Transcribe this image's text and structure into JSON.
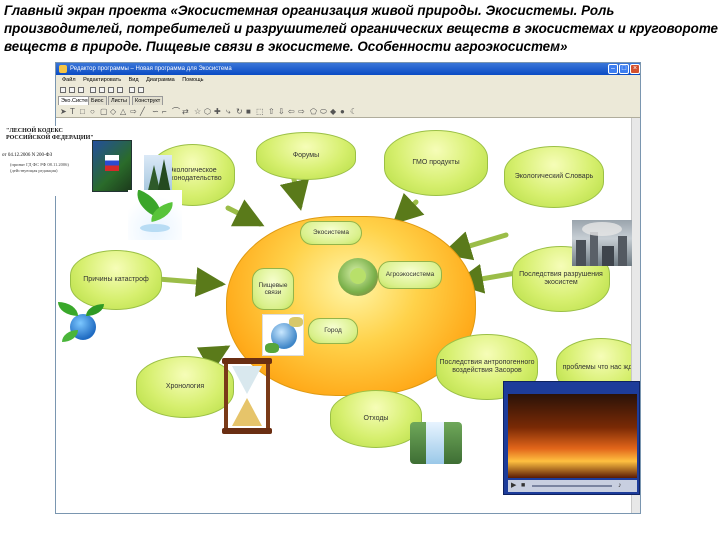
{
  "slide": {
    "title_lines": [
      "Главный экран проекта «Экосистемная организация живой природы. Экосистемы. Роль",
      "производителей, потребителей и разрушителей органических веществ в экосистемах и круговороте",
      "веществ в природе. Пищевые связи в экосистеме. Особенности агроэкосистем»"
    ]
  },
  "window": {
    "title": "Редактор программы – Новая программа для Экосистема",
    "menu": [
      "Файл",
      "Редактировать",
      "Вид",
      "Диаграмма",
      "Помощь"
    ],
    "tabs": [
      "Эко.Система",
      "Биос",
      "Листы",
      "Конструкт"
    ],
    "active_tab": 0
  },
  "document_caption": {
    "title": "\"ЛЕСНОЙ КОДЕКС РОССИЙСКОЙ ФЕДЕРАЦИИ\"",
    "number": "от 04.12.2006 N 200-ФЗ",
    "note": "(принят ГД ФС РФ 08.11.2006) (действующая редакция)"
  },
  "concept_map": {
    "outer_nodes": [
      {
        "id": "law",
        "label": "Экологическое законодательство"
      },
      {
        "id": "forums",
        "label": "Форумы"
      },
      {
        "id": "gmo",
        "label": "ГМО продукты"
      },
      {
        "id": "dict",
        "label": "Экологический Словарь"
      },
      {
        "id": "disaster",
        "label": "Причины катастроф"
      },
      {
        "id": "consequences",
        "label": "Последствия разрушения экосистем"
      },
      {
        "id": "chronology",
        "label": "Хронология"
      },
      {
        "id": "influence",
        "label": "Последствия антропогенного воздействия Засоров"
      },
      {
        "id": "problems",
        "label": "проблемы что нас ждёт"
      },
      {
        "id": "offsets",
        "label": "Отходы"
      }
    ],
    "inner_nodes": [
      {
        "id": "ecosystem",
        "label": "Экосистема"
      },
      {
        "id": "food",
        "label": "Пищевые связи"
      },
      {
        "id": "agro",
        "label": "Агроэкосистема"
      },
      {
        "id": "city",
        "label": "Город"
      }
    ]
  },
  "colors": {
    "node_fill": "#d6ef6e",
    "center_fill": "#ffac1c",
    "arrow": "#8bb13a",
    "titlebar": "#0a4bc4"
  }
}
